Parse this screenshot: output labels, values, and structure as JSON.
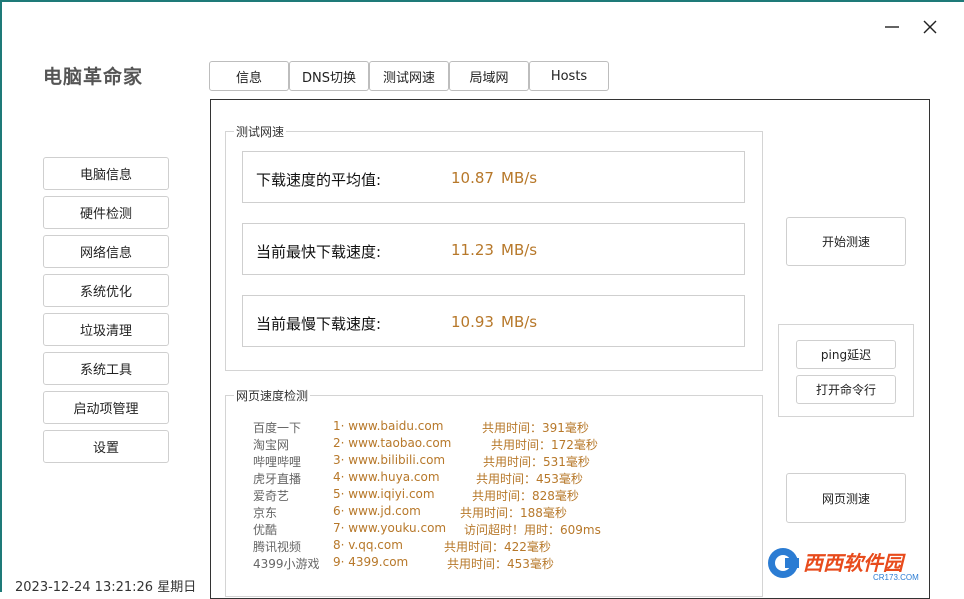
{
  "app": {
    "title": "电脑革命家"
  },
  "window_controls": {
    "minimize": "minimize",
    "close": "close"
  },
  "sidebar": {
    "items": [
      {
        "label": "电脑信息"
      },
      {
        "label": "硬件检测"
      },
      {
        "label": "网络信息"
      },
      {
        "label": "系统优化"
      },
      {
        "label": "垃圾清理"
      },
      {
        "label": "系统工具"
      },
      {
        "label": "启动项管理"
      },
      {
        "label": "设置"
      }
    ]
  },
  "tabs": [
    {
      "label": "信息"
    },
    {
      "label": "DNS切换"
    },
    {
      "label": "测试网速"
    },
    {
      "label": "局域网"
    },
    {
      "label": "Hosts"
    }
  ],
  "speed_test": {
    "group_title": "测试网速",
    "rows": [
      {
        "label": "下载速度的平均值:",
        "value": "10.87",
        "unit": "MB/s"
      },
      {
        "label": "当前最快下载速度:",
        "value": "11.23",
        "unit": "MB/s"
      },
      {
        "label": "当前最慢下载速度:",
        "value": "10.93",
        "unit": "MB/s"
      }
    ]
  },
  "buttons": {
    "start_test": "开始测速",
    "ping": "ping延迟",
    "open_cmd": "打开命令行",
    "web_test": "网页测速"
  },
  "web_speed": {
    "group_title": "网页速度检测",
    "sites": [
      {
        "name": "百度一下",
        "url": "1· www.baidu.com",
        "time": "共用时间：391毫秒"
      },
      {
        "name": "淘宝网",
        "url": "2· www.taobao.com",
        "time": "共用时间：172毫秒"
      },
      {
        "name": "哔哩哔哩",
        "url": "3· www.bilibili.com",
        "time": "共用时间：531毫秒"
      },
      {
        "name": "虎牙直播",
        "url": "4· www.huya.com",
        "time": "共用时间：453毫秒"
      },
      {
        "name": "爱奇艺",
        "url": "5· www.iqiyi.com",
        "time": "共用时间：828毫秒"
      },
      {
        "name": "京东",
        "url": "6· www.jd.com",
        "time": "共用时间：188毫秒"
      },
      {
        "name": "优酷",
        "url": "7· www.youku.com",
        "time": "访问超时！用时：609ms"
      },
      {
        "name": "腾讯视频",
        "url": "8· v.qq.com",
        "time": "共用时间：422毫秒"
      },
      {
        "name": "4399小游戏",
        "url": "9· 4399.com",
        "time": "共用时间：453毫秒"
      }
    ]
  },
  "status": {
    "datetime": "2023-12-24 13:21:26 星期日"
  },
  "watermark": {
    "text": "西西软件园",
    "sub": "CR173.COM"
  },
  "colors": {
    "accent_value": "#b7782a",
    "window_border": "#1e7a78"
  }
}
